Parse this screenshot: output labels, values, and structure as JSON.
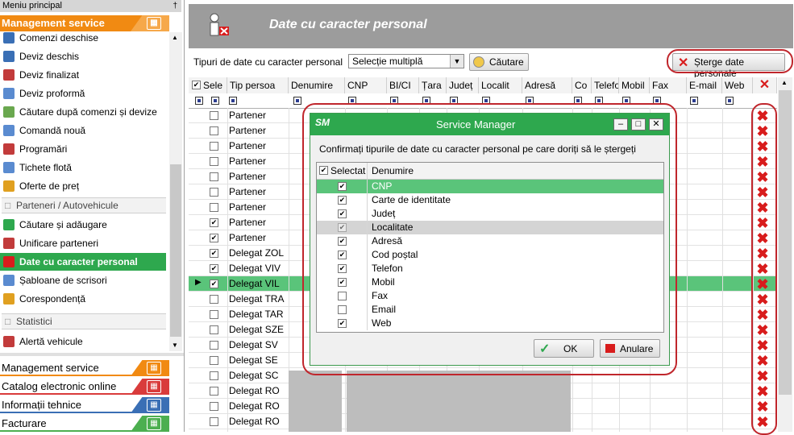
{
  "sidebar": {
    "title": "Meniu principal",
    "pin": "†",
    "section_title": "Management service",
    "items": [
      {
        "label": "Comenzi deschise",
        "icon": "open-orders-icon",
        "color": "#3a6fb5"
      },
      {
        "label": "Deviz deschis",
        "icon": "open-estimate-icon",
        "color": "#3a6fb5"
      },
      {
        "label": "Deviz finalizat",
        "icon": "finished-estimate-icon",
        "color": "#c23b3b"
      },
      {
        "label": "Deviz proformă",
        "icon": "proforma-icon",
        "color": "#5a8bd0"
      },
      {
        "label": "Căutare după comenzi și devize",
        "icon": "search-orders-icon",
        "color": "#6aa84f"
      },
      {
        "label": "Comandă nouă",
        "icon": "new-order-icon",
        "color": "#5a8bd0"
      },
      {
        "label": "Programări",
        "icon": "calendar-icon",
        "color": "#c23b3b"
      },
      {
        "label": "Tichete flotă",
        "icon": "fleet-ticket-icon",
        "color": "#5a8bd0"
      },
      {
        "label": "Oferte de preț",
        "icon": "price-offer-icon",
        "color": "#e0a020"
      }
    ],
    "group_partners": "Parteneri / Autovehicule",
    "partner_items": [
      {
        "label": "Căutare și adăugare",
        "icon": "search-add-icon",
        "color": "#2ea84e"
      },
      {
        "label": "Unificare parteneri",
        "icon": "merge-partners-icon",
        "color": "#c23b3b"
      },
      {
        "label": "Date cu caracter personal",
        "icon": "personal-data-icon",
        "color": "#ffffff"
      },
      {
        "label": "Șabloane de scrisori",
        "icon": "letter-templates-icon",
        "color": "#5a8bd0"
      },
      {
        "label": "Corespondență",
        "icon": "correspondence-icon",
        "color": "#e0a020"
      }
    ],
    "group_stats": "Statistici",
    "stats_items": [
      {
        "label": "Alertă vehicule",
        "icon": "vehicle-alert-icon",
        "color": "#c23b3b"
      }
    ],
    "bottom_bands": [
      {
        "label": "Management service",
        "color": "#f18a12"
      },
      {
        "label": "Catalog electronic online",
        "color": "#d93b3b"
      },
      {
        "label": "Informații tehnice",
        "color": "#3a6fb5"
      },
      {
        "label": "Facturare",
        "color": "#4caf50"
      }
    ]
  },
  "header": {
    "title": "Date cu caracter personal"
  },
  "toolbar": {
    "type_label": "Tipuri de date cu caracter personal",
    "type_value": "Selecție multiplă",
    "search_label": "Căutare",
    "delete_label": "Șterge date personale"
  },
  "grid": {
    "columns": [
      "Sele",
      "Tip persoa",
      "Denumire",
      "CNP",
      "BI/CI",
      "Țara",
      "Județ",
      "Localit",
      "Adresă",
      "Co",
      "Telefo",
      "Mobil",
      "Fax",
      "E-mail",
      "Web"
    ],
    "rows": [
      {
        "checked": false,
        "type": "Partener"
      },
      {
        "checked": false,
        "type": "Partener"
      },
      {
        "checked": false,
        "type": "Partener"
      },
      {
        "checked": false,
        "type": "Partener"
      },
      {
        "checked": false,
        "type": "Partener"
      },
      {
        "checked": false,
        "type": "Partener"
      },
      {
        "checked": false,
        "type": "Partener"
      },
      {
        "checked": true,
        "type": "Partener"
      },
      {
        "checked": true,
        "type": "Partener"
      },
      {
        "checked": true,
        "type": "Delegat ZOL"
      },
      {
        "checked": true,
        "type": "Delegat VIV"
      },
      {
        "checked": true,
        "type": "Delegat VIL",
        "current": true
      },
      {
        "checked": false,
        "type": "Delegat TRA"
      },
      {
        "checked": false,
        "type": "Delegat TAR"
      },
      {
        "checked": false,
        "type": "Delegat SZE"
      },
      {
        "checked": false,
        "type": "Delegat SV"
      },
      {
        "checked": false,
        "type": "Delegat SE"
      },
      {
        "checked": false,
        "type": "Delegat SC"
      },
      {
        "checked": false,
        "type": "Delegat RO"
      },
      {
        "checked": false,
        "type": "Delegat RO"
      },
      {
        "checked": false,
        "type": "Delegat RO"
      }
    ]
  },
  "dialog": {
    "title": "Service Manager",
    "logo": "SM",
    "message": "Confirmați tipurile de date cu caracter personal pe care doriți să le ștergeți",
    "col_selected": "Selectat",
    "col_name": "Denumire",
    "items": [
      {
        "name": "CNP",
        "checked": true,
        "highlight": true
      },
      {
        "name": "Carte de identitate",
        "checked": true
      },
      {
        "name": "Județ",
        "checked": true
      },
      {
        "name": "Localitate",
        "checked": true,
        "disabled": true
      },
      {
        "name": "Adresă",
        "checked": true
      },
      {
        "name": "Cod poștal",
        "checked": true
      },
      {
        "name": "Telefon",
        "checked": true
      },
      {
        "name": "Mobil",
        "checked": true
      },
      {
        "name": "Fax",
        "checked": false
      },
      {
        "name": "Email",
        "checked": false
      },
      {
        "name": "Web",
        "checked": true
      }
    ],
    "ok_label": "OK",
    "cancel_label": "Anulare"
  },
  "colors": {
    "accent_green": "#2ea84e",
    "selection_green": "#5ac47a",
    "highlight_red": "#c0262c",
    "delete_red": "#d81c1c",
    "header_gray": "#9c9c9c"
  }
}
